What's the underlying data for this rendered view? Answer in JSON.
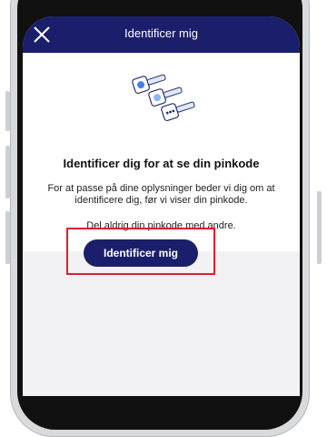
{
  "header": {
    "title": "Identificer mig",
    "close_icon": "close-icon"
  },
  "content": {
    "illustration_icon": "keys-illustration-icon",
    "heading": "Identificer dig for at se din pinkode",
    "body": "For at passe på dine oplysninger beder vi dig om at identificere dig, før vi viser din pinkode.",
    "note": "Del aldrig din pinkode med andre."
  },
  "actions": {
    "primary_label": "Identificer mig"
  },
  "colors": {
    "header_bg": "#1b1f6b",
    "button_bg": "#1b1f6b",
    "highlight": "#e0202a",
    "accent_blue": "#3f7ff0"
  }
}
